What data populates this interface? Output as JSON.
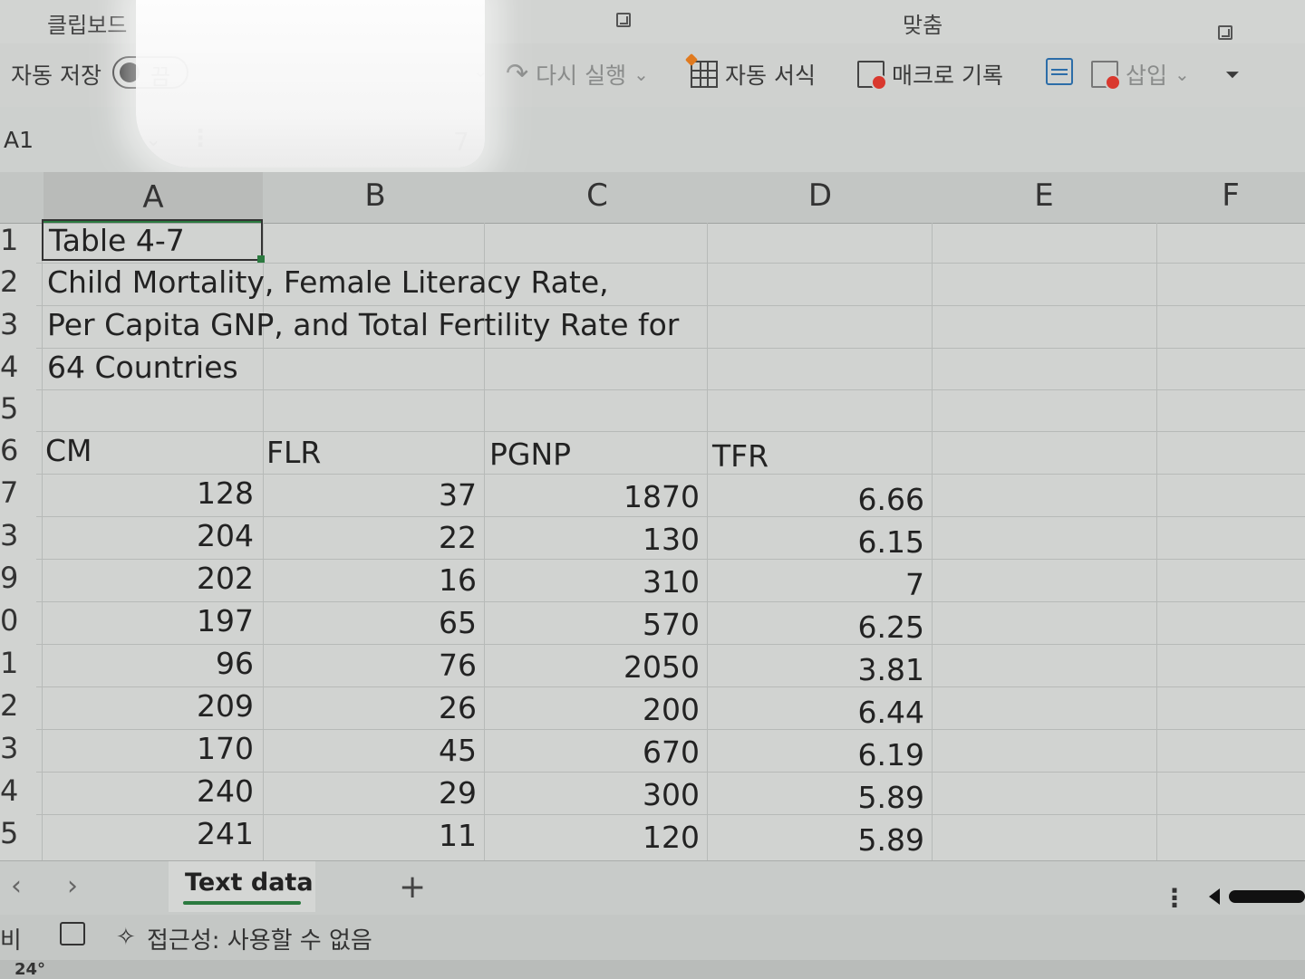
{
  "ribbon": {
    "groups": [
      "클립보드",
      "맞춤"
    ]
  },
  "qat": {
    "autosave_label": "자동 저장",
    "autosave_state": "끔",
    "redo_label": "다시 실행",
    "autoformat_label": "자동 서식",
    "macro_label": "매크로 기록",
    "insert_label": "삽입"
  },
  "formula_bar": {
    "name_box": "A1",
    "content": "7"
  },
  "sheet": {
    "columns": [
      "A",
      "B",
      "C",
      "D",
      "E",
      "F"
    ],
    "rows": [
      "1",
      "2",
      "3",
      "4",
      "5",
      "6",
      "7",
      "3",
      "9",
      "0",
      "1",
      "2",
      "3",
      "4",
      "5"
    ],
    "title": "Table 4-7",
    "desc_line1": "Child Mortality, Female Literacy Rate,",
    "desc_line2": "Per Capita GNP, and Total Fertility Rate for",
    "desc_line3": "64 Countries",
    "headers": [
      "CM",
      "FLR",
      "PGNP",
      "TFR"
    ],
    "data": [
      [
        "128",
        "37",
        "1870",
        "6.66"
      ],
      [
        "204",
        "22",
        "130",
        "6.15"
      ],
      [
        "202",
        "16",
        "310",
        "7"
      ],
      [
        "197",
        "65",
        "570",
        "6.25"
      ],
      [
        "96",
        "76",
        "2050",
        "3.81"
      ],
      [
        "209",
        "26",
        "200",
        "6.44"
      ],
      [
        "170",
        "45",
        "670",
        "6.19"
      ],
      [
        "240",
        "29",
        "300",
        "5.89"
      ],
      [
        "241",
        "11",
        "120",
        "5.89"
      ]
    ]
  },
  "tabs": {
    "active": "Text data",
    "add": "+"
  },
  "status": {
    "ready": "준비",
    "accessibility": "접근성: 사용할 수 없음"
  },
  "taskbar": {
    "temperature": "24°"
  }
}
